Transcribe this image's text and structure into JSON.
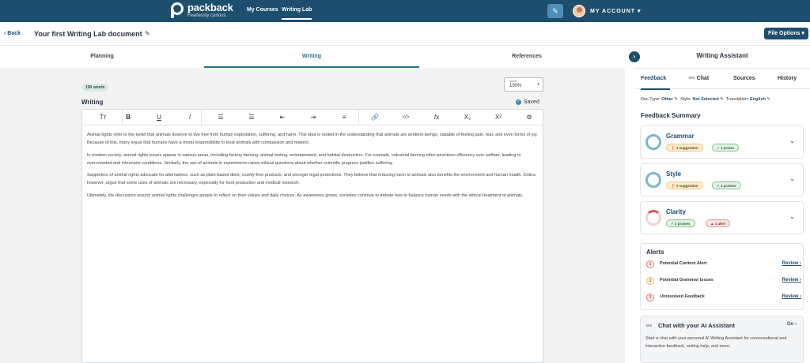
{
  "nav": {
    "logo_name": "packback",
    "logo_tagline": "Fearlessly curious.",
    "links": [
      "My Courses",
      "Writing Lab"
    ],
    "account_label": "MY ACCOUNT ▾"
  },
  "header": {
    "back_label": "‹ Back",
    "doc_title": "Your first Writing Lab document",
    "file_options": "File Options ▾"
  },
  "tabs": [
    "Planning",
    "Writing",
    "References"
  ],
  "editor": {
    "word_count": "190 words",
    "width_label": "Width",
    "width_value": "100%",
    "section_label": "Writing",
    "saved_label": "Saved",
    "toolbar": [
      "Tт",
      "B",
      "U",
      "I",
      "☰",
      "☰",
      "⇤",
      "⇥",
      "≡",
      "🔗",
      "</>",
      "fx",
      "X₂",
      "X²",
      "⚙"
    ],
    "paragraphs": [
      "Animal rights refer to the belief that animals deserve to live free from human exploitation, suffering, and harm. This idea is rooted in the understanding that animals are sentient beings, capable of feeling pain, fear, and even forms of joy. Because of this, many argue that humans have a moral responsibility to treat animals with compassion and respect.",
      "In modern society, animal rights issues appear in various areas, including factory farming, animal testing, entertainment, and habitat destruction. For example, industrial farming often prioritizes efficiency over welfare, leading to overcrowded and inhumane conditions. Similarly, the use of animals in experiments raises ethical questions about whether scientific progress justifies suffering.",
      "Supporters of animal rights advocate for alternatives, such as plant-based diets, cruelty-free products, and stronger legal protections. They believe that reducing harm to animals also benefits the environment and human health. Critics, however, argue that some uses of animals are necessary, especially for food production and medical research.",
      "Ultimately, the discussion around animal rights challenges people to reflect on their values and daily choices. As awareness grows, societies continue to debate how to balance human needs with the ethical treatment of animals."
    ]
  },
  "assistant": {
    "title": "Writing Assistant",
    "tabs": [
      "Feedback",
      "Chat",
      "Sources",
      "History"
    ],
    "doc_type_label": "Doc Type:",
    "doc_type_value": "Other",
    "style_label": "Style:",
    "style_value": "Not Selected",
    "translation_label": "Translation:",
    "translation_value": "English",
    "summary_title": "Feedback Summary",
    "cards": [
      {
        "title": "Grammar",
        "chip1": "1 suggestion",
        "chip2": "1 praise"
      },
      {
        "title": "Style",
        "chip1": "1 suggestion",
        "chip2": "3 praises"
      },
      {
        "title": "Clarity",
        "chip1": "3 praises",
        "chip2": "1 alert"
      }
    ],
    "alerts_title": "Alerts",
    "alerts": [
      {
        "num": "1",
        "label": "Potential Content Alert",
        "action": "Review ›"
      },
      {
        "num": "1",
        "label": "Potential Grammar Issues",
        "action": "Review ›"
      },
      {
        "num": "3",
        "label": "Unresolved Feedback",
        "action": "Review ›"
      }
    ],
    "chat_title": "Chat with your AI Assistant",
    "chat_go": "Go ›",
    "chat_body": "Start a chat with your personal AI Writing Assistant for conversational and interactive feedback, writing help, and more."
  }
}
